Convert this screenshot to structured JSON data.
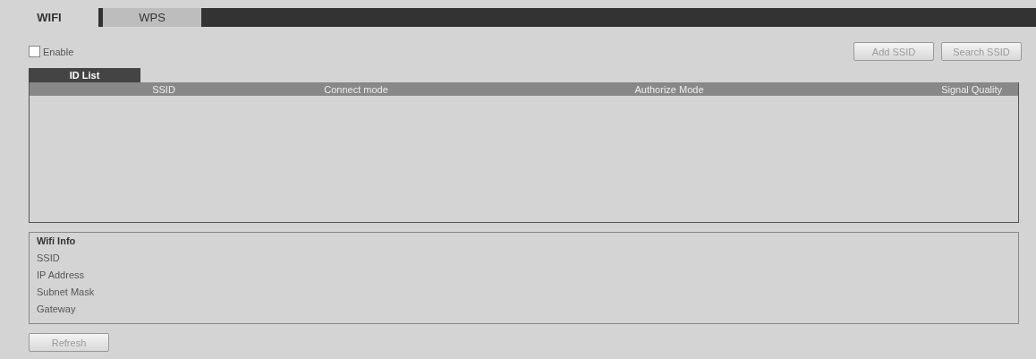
{
  "tabs": [
    {
      "label": "WIFI",
      "selected": true
    },
    {
      "label": "WPS",
      "selected": false
    }
  ],
  "enable": {
    "label": "Enable",
    "checked": false
  },
  "buttons": [
    "Add SSID",
    "Search SSID"
  ],
  "id_list": {
    "tab": "ID List",
    "columns": [
      "SSID",
      "Connect mode",
      "Authorize Mode",
      "Signal Quality"
    ]
  },
  "wifi_info": {
    "title": "Wifi Info",
    "fields": [
      "SSID",
      "IP Address",
      "Subnet Mask",
      "Gateway"
    ]
  },
  "refresh_button": "Refresh"
}
